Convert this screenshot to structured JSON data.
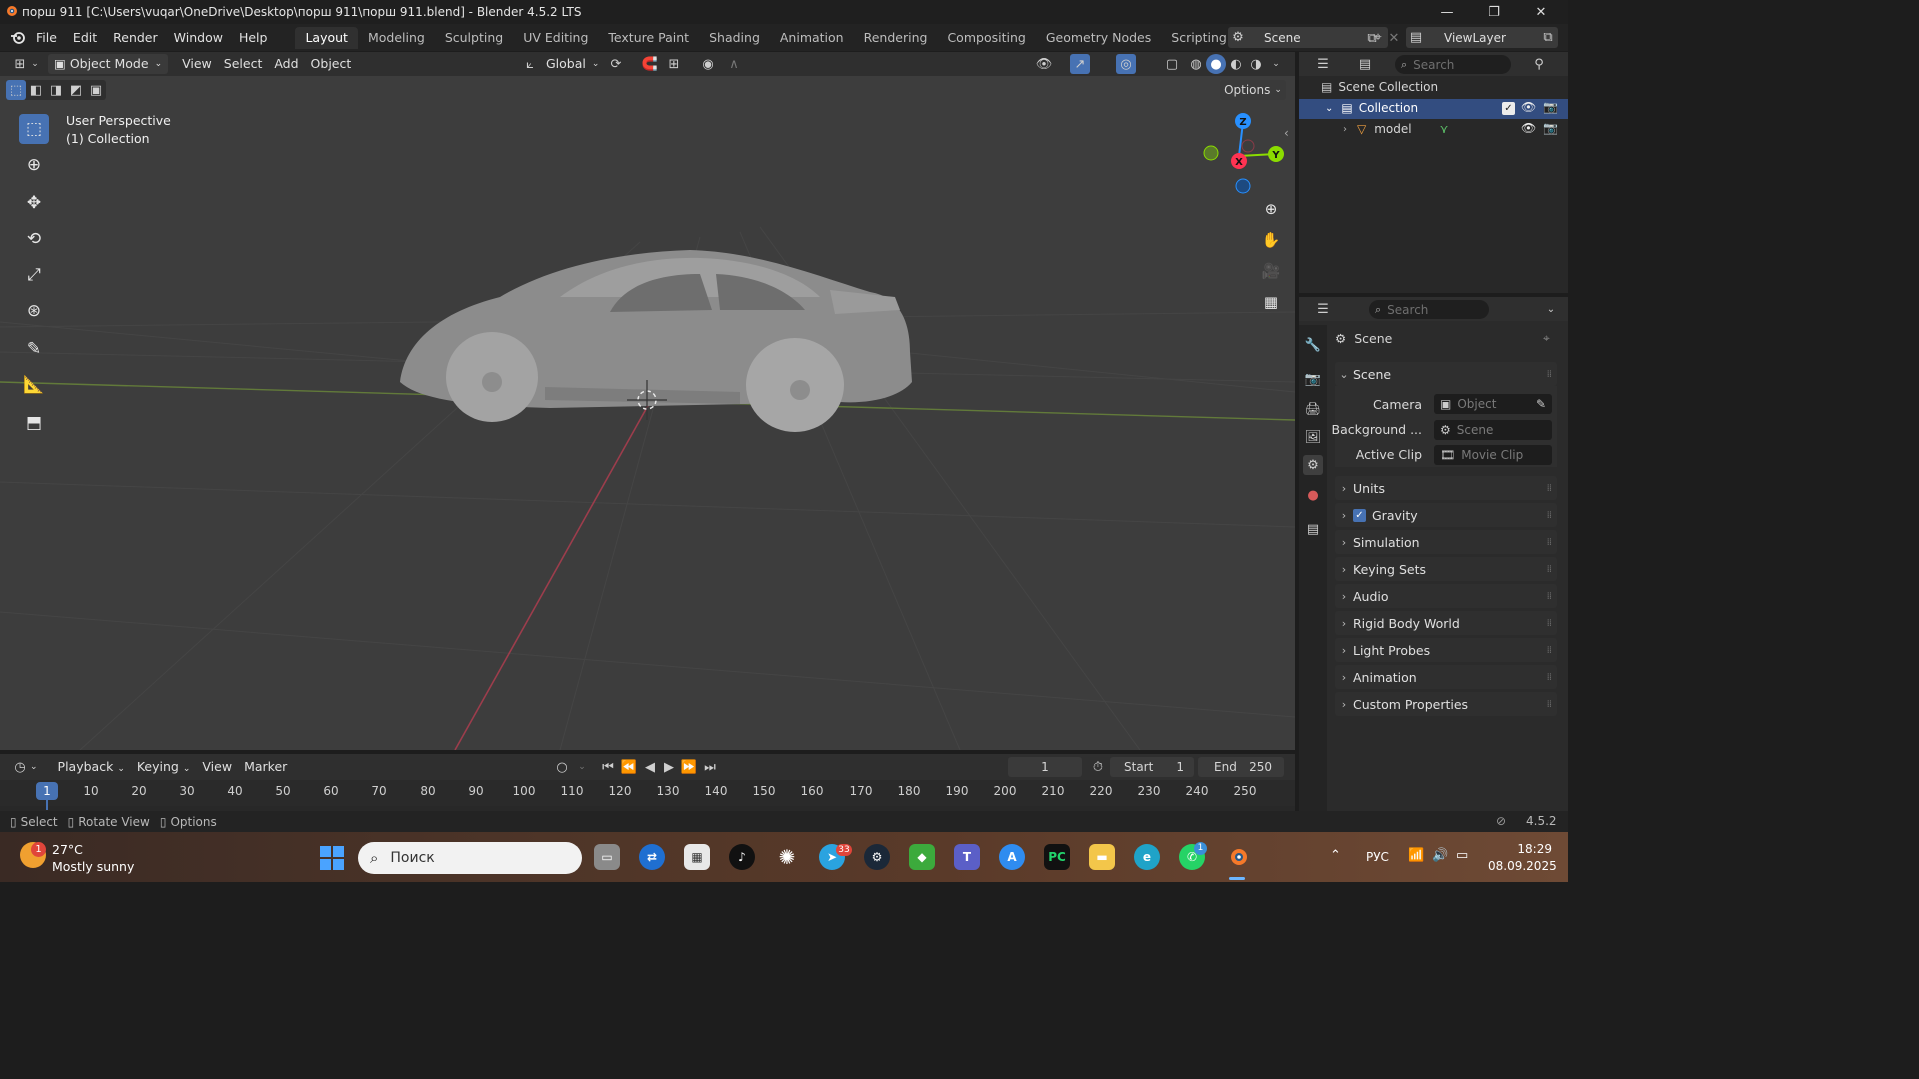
{
  "window": {
    "title": "порш 911 [C:\\Users\\vuqar\\OneDrive\\Desktop\\порш 911\\порш 911.blend] - Blender 4.5.2 LTS",
    "controls": [
      "minimize",
      "maximize",
      "close"
    ]
  },
  "menu": {
    "items": [
      "File",
      "Edit",
      "Render",
      "Window",
      "Help"
    ]
  },
  "workspaces": {
    "tabs": [
      "Layout",
      "Modeling",
      "Sculpting",
      "UV Editing",
      "Texture Paint",
      "Shading",
      "Animation",
      "Rendering",
      "Compositing",
      "Geometry Nodes",
      "Scripting"
    ],
    "active": "Layout",
    "add_label": "+"
  },
  "topright": {
    "scene_name": "Scene",
    "viewlayer_name": "ViewLayer"
  },
  "viewport": {
    "mode": "Object Mode",
    "menus": [
      "View",
      "Select",
      "Add",
      "Object"
    ],
    "orientation": "Global",
    "options_label": "Options",
    "overlay_text_line1": "User Perspective",
    "overlay_text_line2": "(1) Collection",
    "gizmo_axes": [
      "Z",
      "Y",
      "X"
    ],
    "tools": [
      "select-box",
      "cursor",
      "move",
      "rotate",
      "scale",
      "transform",
      "annotate",
      "measure",
      "add-cube"
    ],
    "active_tool": "select-box",
    "nav_buttons": [
      "zoom",
      "pan",
      "camera",
      "perspective-toggle"
    ],
    "model_description": "gray car mesh"
  },
  "outliner": {
    "search_placeholder": "Search",
    "root_label": "Scene Collection",
    "collection_label": "Collection",
    "object_label": "model"
  },
  "properties": {
    "search_placeholder": "Search",
    "context_title": "Scene",
    "section_scene": "Scene",
    "camera_label": "Camera",
    "camera_placeholder": "Object",
    "background_label": "Background ...",
    "background_placeholder": "Scene",
    "activeclip_label": "Active Clip",
    "activeclip_placeholder": "Movie Clip",
    "panels": [
      "Units",
      "Gravity",
      "Simulation",
      "Keying Sets",
      "Audio",
      "Rigid Body World",
      "Light Probes",
      "Animation",
      "Custom Properties"
    ],
    "gravity_checked": true
  },
  "timeline": {
    "menus": [
      "Playback",
      "Keying",
      "View",
      "Marker"
    ],
    "current_frame": "1",
    "start_label": "Start",
    "start_value": "1",
    "end_label": "End",
    "end_value": "250",
    "frame_ticks": [
      "1",
      "10",
      "20",
      "30",
      "40",
      "50",
      "60",
      "70",
      "80",
      "90",
      "100",
      "110",
      "120",
      "130",
      "140",
      "150",
      "160",
      "170",
      "180",
      "190",
      "200",
      "210",
      "220",
      "230",
      "240",
      "250"
    ]
  },
  "statusbar": {
    "select_label": "Select",
    "rotate_label": "Rotate View",
    "options_label": "Options",
    "version": "4.5.2"
  },
  "taskbar": {
    "weather_temp": "27°C",
    "weather_desc": "Mostly sunny",
    "weather_badge": "1",
    "search_placeholder": "Поиск",
    "telegram_badge": "33",
    "whatsapp_badge": "1",
    "language": "РУС",
    "time": "18:29",
    "date": "08.09.2025",
    "colors": {
      "start_blue": "#4aa3ff",
      "blender_orange": "#f5792a"
    }
  },
  "colors": {
    "accent_blue": "#4772b3",
    "axis_x": "#ff3352",
    "axis_y": "#8bdc00",
    "axis_z": "#2890ff"
  }
}
